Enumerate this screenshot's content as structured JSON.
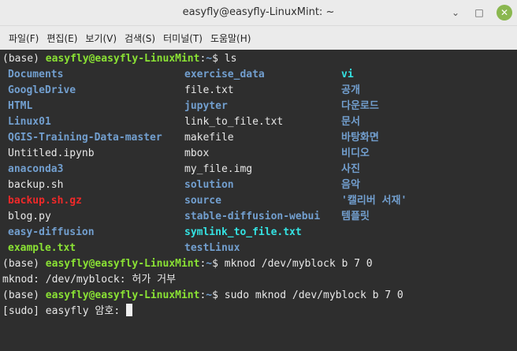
{
  "window": {
    "title": "easyfly@easyfly-LinuxMint: ~",
    "minimize_glyph": "⌄",
    "maximize_glyph": "□",
    "close_glyph": "✕"
  },
  "menu": [
    "파일(F)",
    "편집(E)",
    "보기(V)",
    "검색(S)",
    "터미널(T)",
    "도움말(H)"
  ],
  "prompt": {
    "env": "(base) ",
    "user": "easyfly@easyfly-LinuxMint",
    "sep": ":",
    "path": "~",
    "dollar": "$ "
  },
  "commands": {
    "ls": "ls",
    "mknod": "mknod /dev/myblock b 7 0",
    "mknod_error": "mknod: /dev/myblock: 허가 거부",
    "sudo": "sudo mknod /dev/myblock b 7 0",
    "sudo_prompt": "[sudo] easyfly 암호: "
  },
  "ls_rows": [
    [
      {
        "text": "Documents",
        "kind": "dir"
      },
      {
        "text": "exercise_data",
        "kind": "dir"
      },
      {
        "text": "vi",
        "kind": "link"
      }
    ],
    [
      {
        "text": "GoogleDrive",
        "kind": "dir"
      },
      {
        "text": "file.txt",
        "kind": "file"
      },
      {
        "text": "공개",
        "kind": "dir"
      }
    ],
    [
      {
        "text": "HTML",
        "kind": "dir"
      },
      {
        "text": "jupyter",
        "kind": "dir"
      },
      {
        "text": "다운로드",
        "kind": "dir"
      }
    ],
    [
      {
        "text": "Linux01",
        "kind": "dir"
      },
      {
        "text": "link_to_file.txt",
        "kind": "file"
      },
      {
        "text": "문서",
        "kind": "dir"
      }
    ],
    [
      {
        "text": "QGIS-Training-Data-master",
        "kind": "dir"
      },
      {
        "text": "makefile",
        "kind": "file"
      },
      {
        "text": "바탕화면",
        "kind": "dir"
      }
    ],
    [
      {
        "text": "Untitled.ipynb",
        "kind": "file"
      },
      {
        "text": "mbox",
        "kind": "file"
      },
      {
        "text": "비디오",
        "kind": "dir"
      }
    ],
    [
      {
        "text": "anaconda3",
        "kind": "dir"
      },
      {
        "text": "my_file.img",
        "kind": "file"
      },
      {
        "text": "사진",
        "kind": "dir"
      }
    ],
    [
      {
        "text": "backup.sh",
        "kind": "file"
      },
      {
        "text": "solution",
        "kind": "dir"
      },
      {
        "text": "음악",
        "kind": "dir"
      }
    ],
    [
      {
        "text": "backup.sh.gz",
        "kind": "arch"
      },
      {
        "text": "source",
        "kind": "dir"
      },
      {
        "text": "'캘리버 서재'",
        "kind": "dir"
      }
    ],
    [
      {
        "text": "blog.py",
        "kind": "file"
      },
      {
        "text": "stable-diffusion-webui",
        "kind": "dir"
      },
      {
        "text": "템플릿",
        "kind": "dir"
      }
    ],
    [
      {
        "text": "easy-diffusion",
        "kind": "dir"
      },
      {
        "text": "symlink_to_file.txt",
        "kind": "link"
      },
      {
        "text": "",
        "kind": "file"
      }
    ],
    [
      {
        "text": "example.txt",
        "kind": "exec"
      },
      {
        "text": "testLinux",
        "kind": "dir"
      },
      {
        "text": "",
        "kind": "file"
      }
    ]
  ]
}
